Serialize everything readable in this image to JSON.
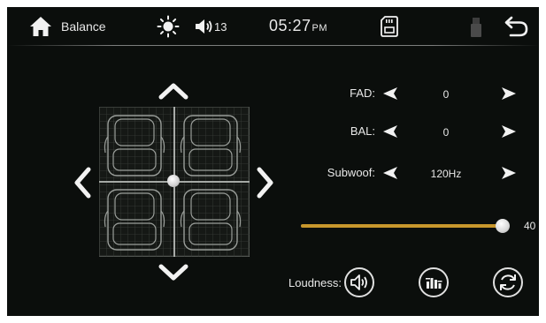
{
  "header": {
    "title": "Balance",
    "volume": "13",
    "time": "05:27",
    "ampm": "PM",
    "icons": [
      "home-icon",
      "brightness-icon",
      "speaker-icon",
      "sd-card-icon",
      "usb-icon",
      "back-icon"
    ]
  },
  "settings": {
    "fad_label": "FAD:",
    "fad_value": "0",
    "bal_label": "BAL:",
    "bal_value": "0",
    "subwoof_label": "Subwoof:",
    "subwoof_value": "120Hz"
  },
  "slider": {
    "value_text": "40",
    "fraction": 1.0
  },
  "loudness": {
    "label": "Loudness:"
  },
  "colors": {
    "accent": "#c8972c",
    "background": "#0b0e0c",
    "foreground": "#e8e8e8"
  }
}
